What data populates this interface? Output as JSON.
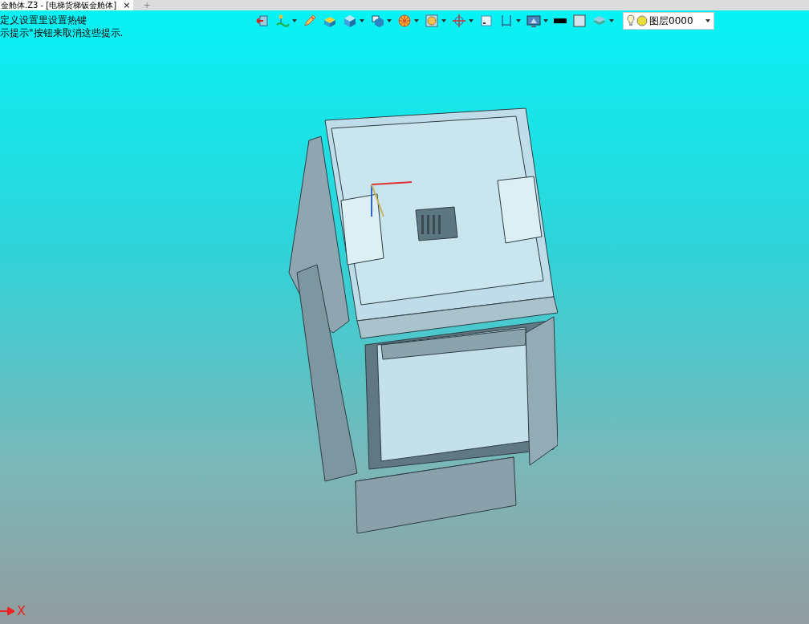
{
  "tab": {
    "title": "金舱体.Z3 - [电梯货梯钣金舱体]",
    "close": "×",
    "new_tab": "+"
  },
  "hints": [
    "定义设置里设置热键",
    "示提示\"按钮来取消这些提示."
  ],
  "toolbar": [
    {
      "kind": "exit",
      "dropdown": false
    },
    {
      "kind": "sketch",
      "dropdown": true
    },
    {
      "kind": "pencil",
      "dropdown": false
    },
    {
      "kind": "extrude",
      "dropdown": false
    },
    {
      "kind": "solid",
      "dropdown": true
    },
    {
      "kind": "view",
      "dropdown": true
    },
    {
      "kind": "render",
      "dropdown": true
    },
    {
      "kind": "zoom",
      "dropdown": true
    },
    {
      "kind": "target",
      "dropdown": true
    },
    {
      "kind": "frame",
      "dropdown": false
    },
    {
      "kind": "dimension",
      "dropdown": true
    },
    {
      "kind": "network",
      "dropdown": true
    },
    {
      "kind": "line-color",
      "dropdown": false
    },
    {
      "kind": "fill-color",
      "dropdown": false
    },
    {
      "kind": "layers",
      "dropdown": true
    }
  ],
  "layer_select": {
    "value": "图层0000"
  },
  "axis_label": "X"
}
